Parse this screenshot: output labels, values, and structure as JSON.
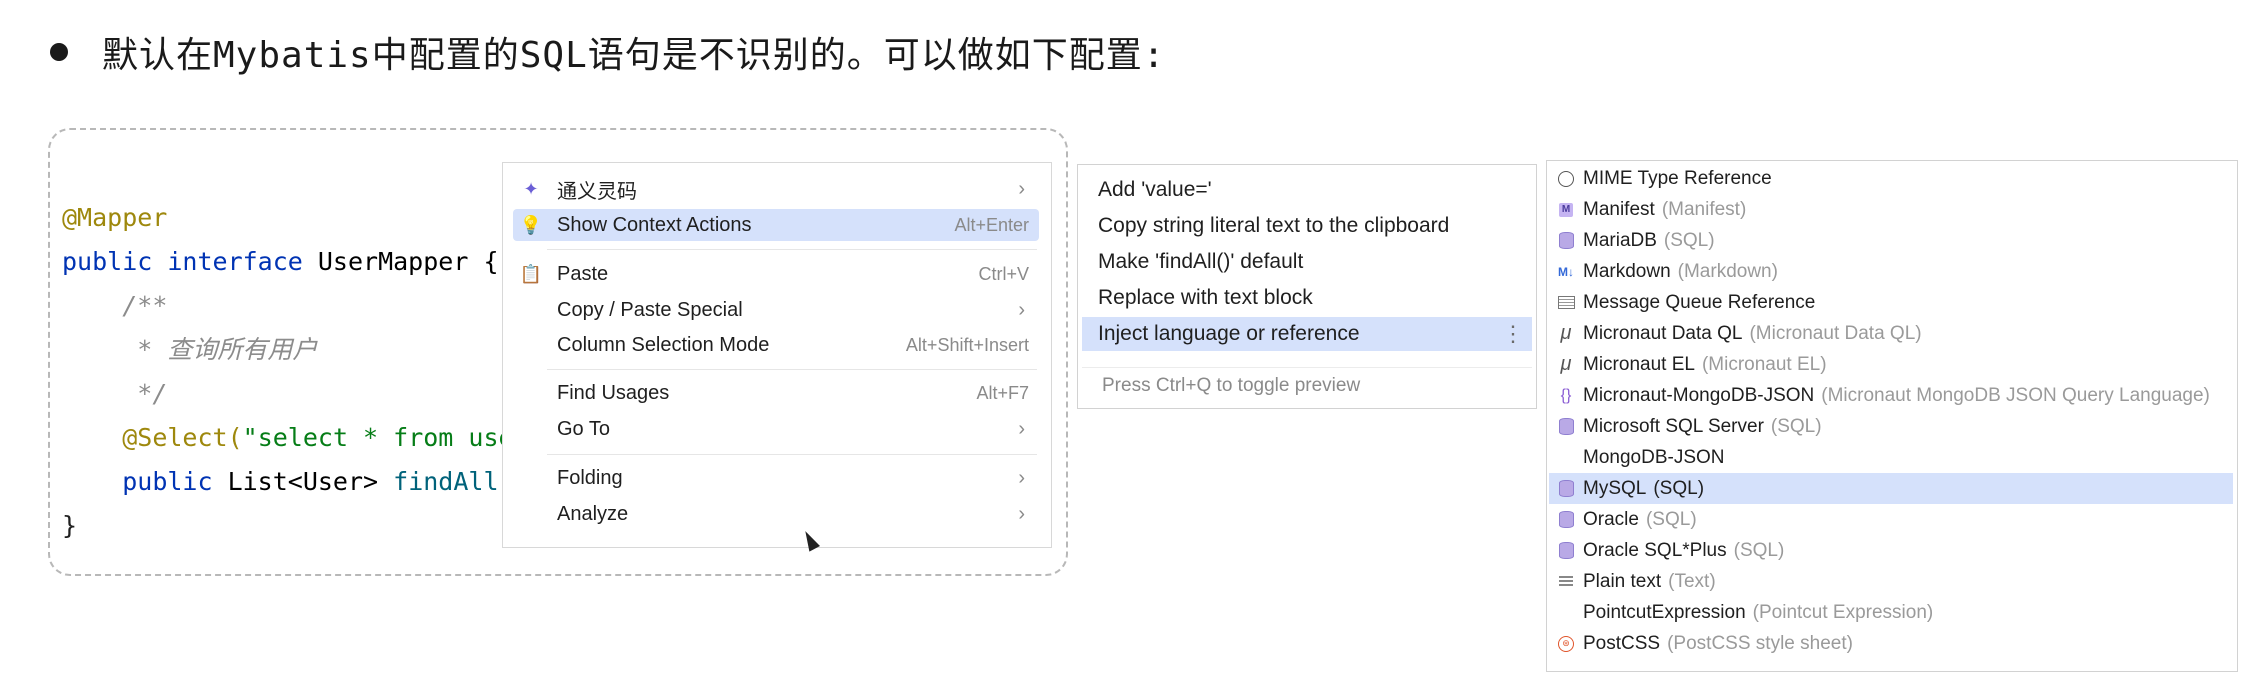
{
  "heading": "默认在Mybatis中配置的SQL语句是不识别的。可以做如下配置:",
  "code": {
    "line1": "@Mapper",
    "line2_kw": "public interface ",
    "line2_name": "UserMapper {",
    "line3": "/**",
    "line4": " * 查询所有用户",
    "line5": " */",
    "line6_anno": "@Select(",
    "line6_str": "\"select * from user",
    "line7_kw": "public ",
    "line7_type": "List<User> ",
    "line7_method": "findAll()",
    "line8": "}"
  },
  "context_menu": {
    "items": [
      {
        "label": "通义灵码",
        "shortcut": "",
        "submenu": true
      },
      {
        "label": "Show Context Actions",
        "shortcut": "Alt+Enter",
        "submenu": false
      },
      {
        "label": "Paste",
        "shortcut": "Ctrl+V",
        "submenu": false
      },
      {
        "label": "Copy / Paste Special",
        "shortcut": "",
        "submenu": true
      },
      {
        "label": "Column Selection Mode",
        "shortcut": "Alt+Shift+Insert",
        "submenu": false
      },
      {
        "label": "Find Usages",
        "shortcut": "Alt+F7",
        "submenu": false
      },
      {
        "label": "Go To",
        "shortcut": "",
        "submenu": true
      },
      {
        "label": "Folding",
        "shortcut": "",
        "submenu": true
      },
      {
        "label": "Analyze",
        "shortcut": "",
        "submenu": true
      }
    ],
    "selected": "Show Context Actions"
  },
  "intentions": {
    "items": [
      "Add 'value='",
      "Copy string literal text to the clipboard",
      "Make 'findAll()' default",
      "Replace with text block",
      "Inject language or reference"
    ],
    "selected": "Inject language or reference",
    "hint": "Press Ctrl+Q to toggle preview"
  },
  "languages": {
    "items": [
      {
        "name": "MIME Type Reference",
        "hint": "",
        "icon": "globe-icon"
      },
      {
        "name": "Manifest",
        "hint": "(Manifest)",
        "icon": "manifest-icon"
      },
      {
        "name": "MariaDB",
        "hint": "(SQL)",
        "icon": "database-icon"
      },
      {
        "name": "Markdown",
        "hint": "(Markdown)",
        "icon": "markdown-icon"
      },
      {
        "name": "Message Queue Reference",
        "hint": "",
        "icon": "message-queue-icon"
      },
      {
        "name": "Micronaut Data QL",
        "hint": "(Micronaut Data QL)",
        "icon": "mu-icon"
      },
      {
        "name": "Micronaut EL",
        "hint": "(Micronaut EL)",
        "icon": "mu-icon"
      },
      {
        "name": "Micronaut-MongoDB-JSON",
        "hint": "(Micronaut MongoDB JSON Query Language)",
        "icon": "braces-icon"
      },
      {
        "name": "Microsoft SQL Server",
        "hint": "(SQL)",
        "icon": "database-icon"
      },
      {
        "name": "MongoDB-JSON",
        "hint": "",
        "icon": "none"
      },
      {
        "name": "MySQL",
        "hint": "(SQL)",
        "icon": "database-icon"
      },
      {
        "name": "Oracle",
        "hint": "(SQL)",
        "icon": "database-icon"
      },
      {
        "name": "Oracle SQL*Plus",
        "hint": "(SQL)",
        "icon": "database-icon"
      },
      {
        "name": "Plain text",
        "hint": "(Text)",
        "icon": "text-icon"
      },
      {
        "name": "PointcutExpression",
        "hint": "(Pointcut Expression)",
        "icon": "none"
      },
      {
        "name": "PostCSS",
        "hint": "(PostCSS style sheet)",
        "icon": "postcss-icon"
      }
    ],
    "selected": "MySQL (SQL)"
  },
  "colors": {
    "selection": "#d5e1fb",
    "annotation": "#9e880d",
    "keyword": "#0033b3",
    "string": "#067d17",
    "method": "#00627a"
  }
}
